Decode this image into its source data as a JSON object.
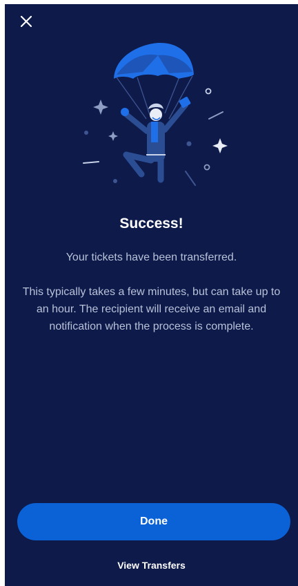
{
  "screen": {
    "title": "Success!",
    "subtitle": "Your tickets have been transferred.",
    "body": "This typically takes a few minutes, but can take up to an hour. The recipient will receive an email and notification when the process is complete."
  },
  "actions": {
    "done_label": "Done",
    "view_transfers_label": "View Transfers"
  },
  "icons": {
    "close": "close-icon",
    "illustration": "parachute-person-illustration"
  },
  "colors": {
    "background": "#0d1a4a",
    "primary_button": "#0a62d6",
    "title": "#ffffff",
    "body_text": "#b9c2d9"
  }
}
